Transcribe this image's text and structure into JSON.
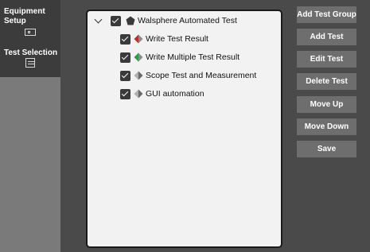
{
  "nav": {
    "items": [
      {
        "label": "Equipment Setup",
        "icon": "equipment-icon"
      },
      {
        "label": "Test Selection",
        "icon": "test-list-icon"
      }
    ]
  },
  "tree": {
    "root": {
      "label": "Walsphere Automated Test",
      "checked": true,
      "expanded": true,
      "icon": "pentagon-icon"
    },
    "children": [
      {
        "label": "Write Test Result",
        "checked": true,
        "icon": "diamond-red-icon",
        "colors": [
          "#e02020",
          "#8a8a8a"
        ]
      },
      {
        "label": "Write Multiple Test Result",
        "checked": true,
        "icon": "diamond-green-icon",
        "colors": [
          "#18a83a",
          "#8a8a8a"
        ]
      },
      {
        "label": "Scope Test and Measurement",
        "checked": true,
        "icon": "diamond-gray-icon",
        "colors": [
          "#b0b0b0",
          "#6a6a6a"
        ]
      },
      {
        "label": "GUI automation",
        "checked": true,
        "icon": "diamond-gray-icon",
        "colors": [
          "#b0b0b0",
          "#6a6a6a"
        ]
      }
    ]
  },
  "buttons": {
    "add_test_group": "Add Test Group",
    "add_test": "Add Test",
    "edit_test": "Edit Test",
    "delete_test": "Delete Test",
    "move_up": "Move Up",
    "move_down": "Move Down",
    "save": "Save"
  },
  "colors": {
    "background": "#4a4a4a",
    "nav_background": "#3c3c3c",
    "nav_lower": "#7a7a7a",
    "panel": "#f2f2f2",
    "button": "#6e6e6e"
  }
}
